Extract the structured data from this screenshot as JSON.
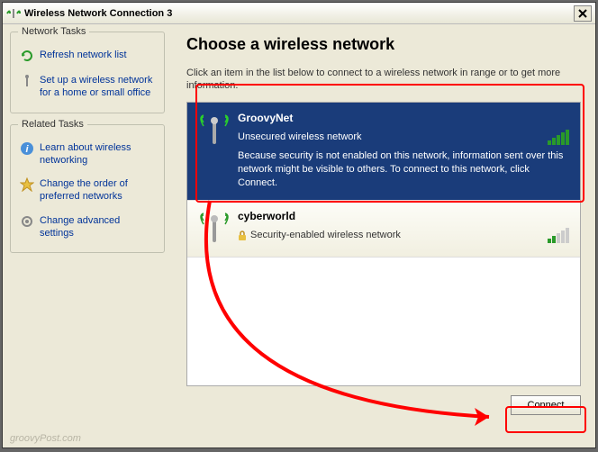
{
  "window": {
    "title": "Wireless Network Connection 3"
  },
  "sidebar": {
    "group1": {
      "title": "Network Tasks"
    },
    "group2": {
      "title": "Related Tasks"
    },
    "tasks1": [
      {
        "label": "Refresh network list"
      },
      {
        "label": "Set up a wireless network for a home or small office"
      }
    ],
    "tasks2": [
      {
        "label": "Learn about wireless networking"
      },
      {
        "label": "Change the order of preferred networks"
      },
      {
        "label": "Change advanced settings"
      }
    ]
  },
  "main": {
    "heading": "Choose a wireless network",
    "desc": "Click an item in the list below to connect to a wireless network in range or to get more information."
  },
  "networks": [
    {
      "name": "GroovyNet",
      "type": "Unsecured wireless network",
      "warn": "Because security is not enabled on this network, information sent over this network might be visible to others. To connect to this network, click Connect."
    },
    {
      "name": "cyberworld",
      "type": "Security-enabled wireless network"
    }
  ],
  "buttons": {
    "connect": "Connect"
  },
  "watermark": "groovyPost.com"
}
